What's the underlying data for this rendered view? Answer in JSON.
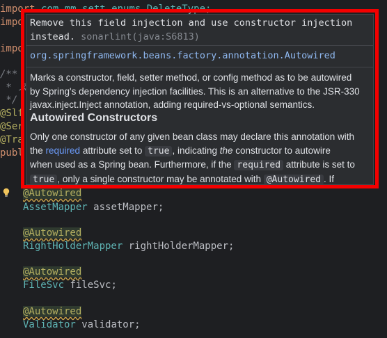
{
  "code_top": {
    "line1": {
      "kw": "import",
      "pkg": "com.mm.sett.enums.DeleteType;"
    },
    "line2": {
      "kw": "impo"
    },
    "line3": {
      "kw": "impo"
    },
    "line4": {
      "text": "/**"
    },
    "line5": {
      "text": " * ス"
    },
    "line6": {
      "text": " */"
    },
    "line7": {
      "text": "@Slf"
    },
    "line8": {
      "text": "@Ser"
    },
    "line9": {
      "text": "@Tra"
    },
    "line10": {
      "text": "publ"
    }
  },
  "fields": [
    {
      "annotation": "@Autowired",
      "type": "AssetMapper",
      "name": "assetMapper;"
    },
    {
      "annotation": "@Autowired",
      "type": "RightHolderMapper",
      "name": "rightHolderMapper;"
    },
    {
      "annotation": "@Autowired",
      "type": "FileSvc",
      "name": "fileSvc;"
    },
    {
      "annotation": "@Autowired",
      "type": "Validator",
      "name": "validator;"
    }
  ],
  "popup": {
    "warning_line1": "Remove this field injection and use constructor injection",
    "warning_line2": "instead.",
    "warning_source": "sonarlint(java:S6813)",
    "fqn": "org.springframework.beans.factory.annotation.Autowired",
    "desc_line1": "Marks a constructor, field, setter method, or config method as to be autowired",
    "desc_line2": "by Spring's dependency injection facilities. This is an alternative to the JSR-330",
    "desc_line3": "javax.inject.Inject annotation, adding required-vs-optional semantics.",
    "heading": "Autowired Constructors",
    "p_line1": "Only one constructor of any given bean class may declare this annotation with",
    "p_line2_a": "the ",
    "p_line2_link": "required",
    "p_line2_b": " attribute set to ",
    "p_line2_code": "true",
    "p_line2_c": ", indicating ",
    "p_line2_em": "the",
    "p_line2_d": " constructor to autowire",
    "p_line3_a": "when used as a Spring bean. Furthermore, if the ",
    "p_line3_code": "required",
    "p_line3_b": " attribute is set to",
    "p_line4_code1": "true",
    "p_line4_a": ", only a single constructor may be annotated with ",
    "p_line4_code2": "@Autowired",
    "p_line4_b": ". If"
  },
  "colors": {
    "highlight_border": "#f40000",
    "annotation": "#b3ae60",
    "keyword": "#cf8e6d",
    "link": "#6b9bfa"
  }
}
